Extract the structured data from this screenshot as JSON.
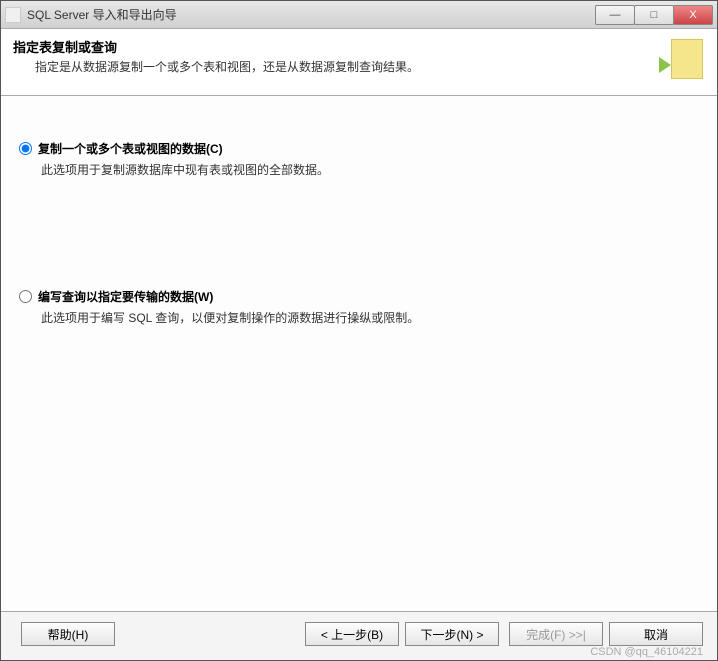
{
  "window": {
    "title": "SQL Server 导入和导出向导"
  },
  "header": {
    "title": "指定表复制或查询",
    "subtitle": "指定是从数据源复制一个或多个表和视图，还是从数据源复制查询结果。"
  },
  "options": {
    "copy": {
      "label": "复制一个或多个表或视图的数据(C)",
      "description": "此选项用于复制源数据库中现有表或视图的全部数据。",
      "selected": true
    },
    "query": {
      "label": "编写查询以指定要传输的数据(W)",
      "description": "此选项用于编写 SQL 查询，以便对复制操作的源数据进行操纵或限制。",
      "selected": false
    }
  },
  "buttons": {
    "help": "帮助(H)",
    "back": "< 上一步(B)",
    "next": "下一步(N) >",
    "finish": "完成(F) >>|",
    "cancel": "取消"
  },
  "watermark": "CSDN @qq_46104221",
  "win_controls": {
    "min": "—",
    "max": "□",
    "close": "X"
  }
}
